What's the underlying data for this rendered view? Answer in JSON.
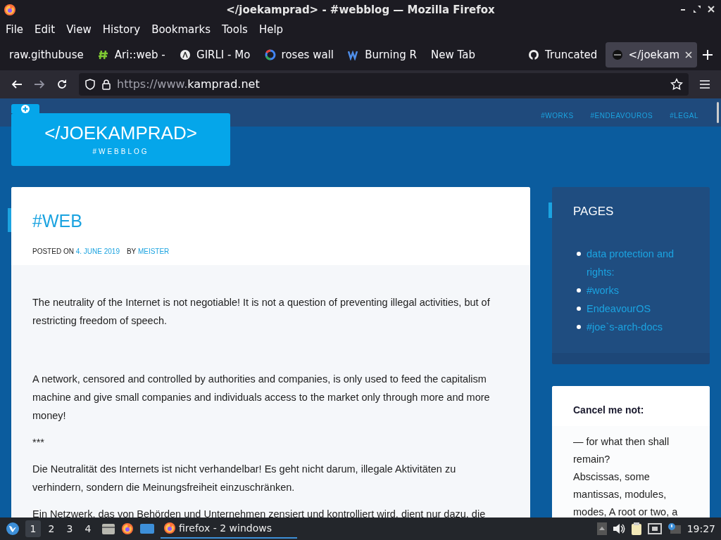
{
  "window": {
    "title": "</joekamprad> - #webblog — Mozilla Firefox"
  },
  "menu": [
    "File",
    "Edit",
    "View",
    "History",
    "Bookmarks",
    "Tools",
    "Help"
  ],
  "tabs": [
    {
      "label": "raw.githubuse",
      "kind": "plain",
      "selected": false
    },
    {
      "label": "Ari::web -",
      "kind": "hash",
      "selected": false
    },
    {
      "label": "GIRLI - Mo",
      "kind": "light",
      "selected": false
    },
    {
      "label": "roses wall",
      "kind": "g",
      "selected": false
    },
    {
      "label": "Burning R",
      "kind": "w",
      "selected": false
    },
    {
      "label": "New Tab",
      "kind": "plain",
      "selected": false
    },
    {
      "label": "Truncated",
      "kind": "cat",
      "selected": false
    },
    {
      "label": "</joekam",
      "kind": "dark",
      "selected": true
    }
  ],
  "address": {
    "prefix": "https://www.",
    "domain": "kamprad.net"
  },
  "site": {
    "logo": "</JOEKAMPRAD>",
    "tagline": "#WEBBLOG",
    "nav": [
      "#WORKS",
      "#ENDEAVOUROS",
      "#LEGAL"
    ]
  },
  "post": {
    "title": "#WEB",
    "meta": "POSTED ON",
    "date": "4. JUNE 2019",
    "by": "BY",
    "author": "MEISTER",
    "paragraphs": [
      "The neutrality of the Internet is not negotiable! It is not a question of preventing illegal activities, but of restricting freedom of speech.",
      "A network, censored and controlled by authorities and companies, is only used to feed the capitalism machine and give small companies and individuals access to the market only through more and more money!",
      "***",
      "Die Neutralität des Internets ist nicht verhandelbar! Es geht nicht darum, illegale Aktivitäten zu verhindern, sondern die Meinungsfreiheit einzuschränken.",
      "Ein Netzwerk, das von Behörden und Unternehmen zensiert und kontrolliert wird, dient nur dazu, die"
    ]
  },
  "pages_widget": {
    "title": "PAGES",
    "items": [
      "data protection and rights:",
      "#works",
      "EndeavourOS",
      "#joe`s-arch-docs"
    ]
  },
  "quote_widget": {
    "title": "Cancel me not:",
    "lines": [
      "— for what then shall remain?",
      "Abscissas, some mantissas, modules, modes, A root or two, a"
    ]
  },
  "taskbar": {
    "workspaces": [
      {
        "label": "1",
        "selected": true
      },
      {
        "label": "2",
        "selected": false
      },
      {
        "label": "3",
        "selected": false
      },
      {
        "label": "4",
        "selected": false
      }
    ],
    "task": "firefox - 2 windows",
    "clock": "19:27"
  }
}
